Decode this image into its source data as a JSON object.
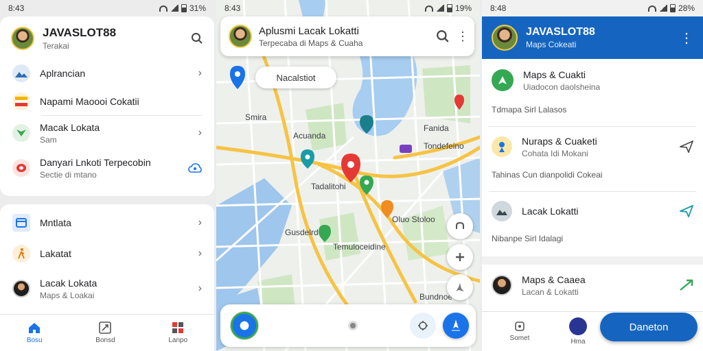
{
  "colors": {
    "accent": "#1a73e8",
    "appbar": "#1565c0",
    "pin_red": "#e53935",
    "pin_green": "#34a853",
    "road": "#f6c343"
  },
  "panel1": {
    "status": {
      "time": "8:43",
      "battery": "31%"
    },
    "header": {
      "title": "JAVASLOT88",
      "subtitle": "Terakai"
    },
    "rows": [
      {
        "label": "Aplrancian",
        "sub": ""
      },
      {
        "label": "Napami Maoooi Cokatii",
        "sub": ""
      },
      {
        "label": "Macak Lokata",
        "sub": "Sam"
      },
      {
        "label": "Danyari Lnkoti Terpecobin",
        "sub": "Sectie di mtano"
      }
    ],
    "rows2": [
      {
        "label": "Mntlata",
        "sub": ""
      },
      {
        "label": "Lakatat",
        "sub": ""
      },
      {
        "label": "Lacak Lokata",
        "sub": "Maps & Loakai"
      }
    ],
    "nav": [
      {
        "label": "Bosu"
      },
      {
        "label": "Bonsd"
      },
      {
        "label": "Lanpo"
      }
    ]
  },
  "panel2": {
    "status": {
      "time": "8:43",
      "battery": "19%"
    },
    "search": {
      "title": "Aplusmi Lacak Lokatti",
      "subtitle": "Terpecaba di Maps & Cuaha"
    },
    "chip": "Nacalstiot",
    "labels": [
      "Smira",
      "Acuanda",
      "Fanida",
      "Tadalitohi",
      "Oluo Stoloo",
      "Gusdelrd",
      "Temuloceidine",
      "Bundnoe",
      "Tondefeino"
    ]
  },
  "panel3": {
    "status": {
      "time": "8:48",
      "battery": "28%"
    },
    "appbar": {
      "title": "JAVASLOT88",
      "subtitle": "Maps Cokeati"
    },
    "items": [
      {
        "label": "Maps & Cuakti",
        "sub": "Uiadocon daolsheina"
      },
      {
        "label": "Nuraps & Cuaketi",
        "sub": "Cohata Idi Mokani"
      },
      {
        "label": "Lacak Lokatti",
        "sub": ""
      }
    ],
    "sections": [
      "Tdmapa Sirl Lalasos",
      "Tahinas Cun dianpolidi Cokeai",
      "Nibanpe Sirl Idalagi"
    ],
    "bottom_item": {
      "label": "Maps & Caaea",
      "sub": "Lacan & Lokatti"
    },
    "nav": [
      {
        "label": "Somet"
      },
      {
        "label": "Hma"
      }
    ],
    "pill": "Daneton"
  }
}
